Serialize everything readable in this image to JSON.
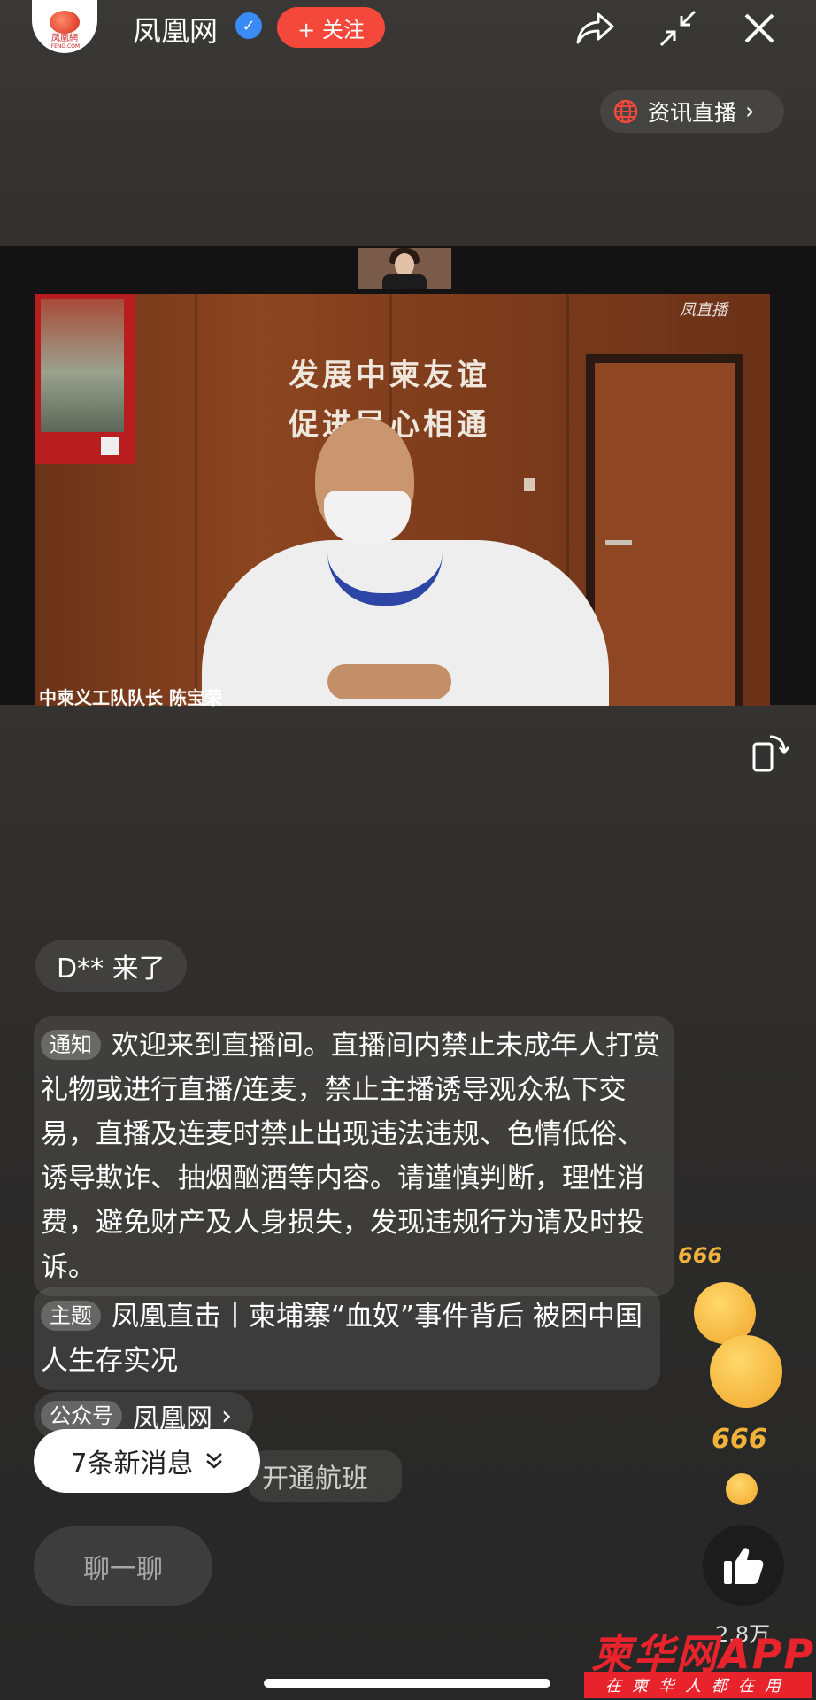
{
  "header": {
    "account_name": "凤凰网",
    "logo_text": "凤凰網",
    "logo_sub": "IFENG.COM",
    "follow_label": "+ 关注",
    "live_tag": "资讯直播"
  },
  "video": {
    "wall_line1": "发展中柬友谊",
    "wall_line2": "促进民心相通",
    "caption": "中柬义工队队长 陈宝荣",
    "watermark": "凤直播"
  },
  "chat": {
    "join_message": "D** 来了",
    "notice_tag": "通知",
    "notice_text": "欢迎来到直播间。直播间内禁止未成年人打赏礼物或进行直播/连麦，禁止主播诱导观众私下交易，直播及连麦时禁止出现违法违规、色情低俗、诱导欺诈、抽烟酗酒等内容。请谨慎判断，理性消费，避免财产及人身损失，发现违规行为请及时投诉。",
    "topic_tag": "主题",
    "topic_text": "凤凰直击丨柬埔寨“血奴”事件背后 被困中国人生存实况",
    "pub_tag": "公众号",
    "pub_name": "凤凰网",
    "faded_message": "开通航班",
    "new_messages": "7条新消息"
  },
  "bottom": {
    "chat_placeholder": "聊一聊",
    "like_count": "2.8万",
    "reaction_text": "666"
  },
  "branding": {
    "main": "柬华网APP",
    "sub": "在柬华人都在用"
  },
  "colors": {
    "follow": "#f4483a",
    "verified": "#3a8bf7",
    "brand": "#e8232c"
  }
}
